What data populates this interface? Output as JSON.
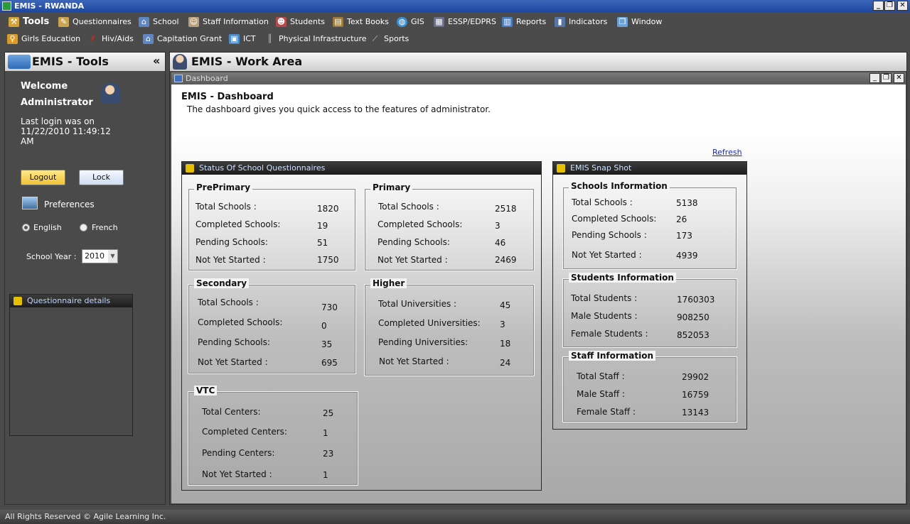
{
  "window": {
    "title": "EMIS - RWANDA"
  },
  "menu": [
    {
      "label": "Tools",
      "icon": "tools-icon"
    },
    {
      "label": "Questionnaires",
      "icon": "questionnaires-icon"
    },
    {
      "label": "School",
      "icon": "school-icon"
    },
    {
      "label": "Staff Information",
      "icon": "staff-icon"
    },
    {
      "label": "Students",
      "icon": "students-icon"
    },
    {
      "label": "Text Books",
      "icon": "textbooks-icon"
    },
    {
      "label": "GIS",
      "icon": "globe-icon"
    },
    {
      "label": "ESSP/EDPRS",
      "icon": "essp-icon"
    },
    {
      "label": "Reports",
      "icon": "reports-icon"
    },
    {
      "label": "Indicators",
      "icon": "indicators-icon"
    },
    {
      "label": "Window",
      "icon": "window-icon"
    },
    {
      "label": "Girls Education",
      "icon": "girls-education-icon"
    },
    {
      "label": "Hiv/Aids",
      "icon": "ribbon-icon"
    },
    {
      "label": "Capitation Grant",
      "icon": "grant-icon"
    },
    {
      "label": "ICT",
      "icon": "ict-icon"
    },
    {
      "label": "Physical Infrastructure",
      "icon": "infrastructure-icon"
    },
    {
      "label": "Sports",
      "icon": "sports-icon"
    }
  ],
  "left": {
    "title": "EMIS - Tools",
    "collapse": "«",
    "welcome": "Welcome",
    "user": "Administrator",
    "last_login_label": "Last login was on",
    "last_login": "11/22/2010 11:49:12",
    "last_login_ampm": "AM",
    "logout": "Logout",
    "lock": "Lock",
    "preferences": "Preferences",
    "lang_en": "English",
    "lang_fr": "French",
    "year_label": "School Year :",
    "year": "2010",
    "qd_title": "Questionnaire details"
  },
  "workarea": {
    "title": "EMIS - Work Area",
    "tab": "Dashboard",
    "heading": "EMIS - Dashboard",
    "desc": "The dashboard gives you quick access to the features of administrator.",
    "refresh": "Refresh"
  },
  "status": {
    "title": "Status Of School Questionnaires",
    "preprimary": {
      "title": "PrePrimary",
      "rows": [
        [
          "Total Schools :",
          "1820"
        ],
        [
          "Completed Schools:",
          "19"
        ],
        [
          "Pending Schools:",
          "51"
        ],
        [
          "Not Yet Started :",
          "1750"
        ]
      ]
    },
    "primary": {
      "title": "Primary",
      "rows": [
        [
          "Total Schools :",
          "2518"
        ],
        [
          "Completed Schools:",
          "3"
        ],
        [
          "Pending Schools:",
          "46"
        ],
        [
          "Not Yet Started :",
          "2469"
        ]
      ]
    },
    "secondary": {
      "title": "Secondary",
      "rows": [
        [
          "Total Schools :",
          "730"
        ],
        [
          "Completed Schools:",
          "0"
        ],
        [
          "Pending Schools:",
          "35"
        ],
        [
          "Not Yet Started :",
          "695"
        ]
      ]
    },
    "higher": {
      "title": "Higher",
      "rows": [
        [
          "Total Universities :",
          "45"
        ],
        [
          "Completed Universities:",
          "3"
        ],
        [
          "Pending Universities:",
          "18"
        ],
        [
          "Not Yet Started :",
          "24"
        ]
      ]
    },
    "vtc": {
      "title": "VTC",
      "rows": [
        [
          "Total Centers:",
          "25"
        ],
        [
          "Completed Centers:",
          "1"
        ],
        [
          "Pending Centers:",
          "23"
        ],
        [
          "Not Yet Started :",
          "1"
        ]
      ]
    }
  },
  "snap": {
    "title": "EMIS Snap Shot",
    "schools": {
      "title": "Schools Information",
      "rows": [
        [
          "Total Schools :",
          "5138"
        ],
        [
          "Completed Schools:",
          "26"
        ],
        [
          "Pending Schools :",
          "173"
        ],
        [
          "Not Yet Started :",
          "4939"
        ]
      ]
    },
    "students": {
      "title": "Students Information",
      "rows": [
        [
          "Total Students :",
          "1760303"
        ],
        [
          "Male Students :",
          "908250"
        ],
        [
          "Female Students :",
          "852053"
        ]
      ]
    },
    "staff": {
      "title": "Staff Information",
      "rows": [
        [
          "Total Staff :",
          "29902"
        ],
        [
          "Male Staff  :",
          "16759"
        ],
        [
          "Female Staff  :",
          "13143"
        ]
      ]
    }
  },
  "footer": "All Rights Reserved © Agile Learning Inc."
}
